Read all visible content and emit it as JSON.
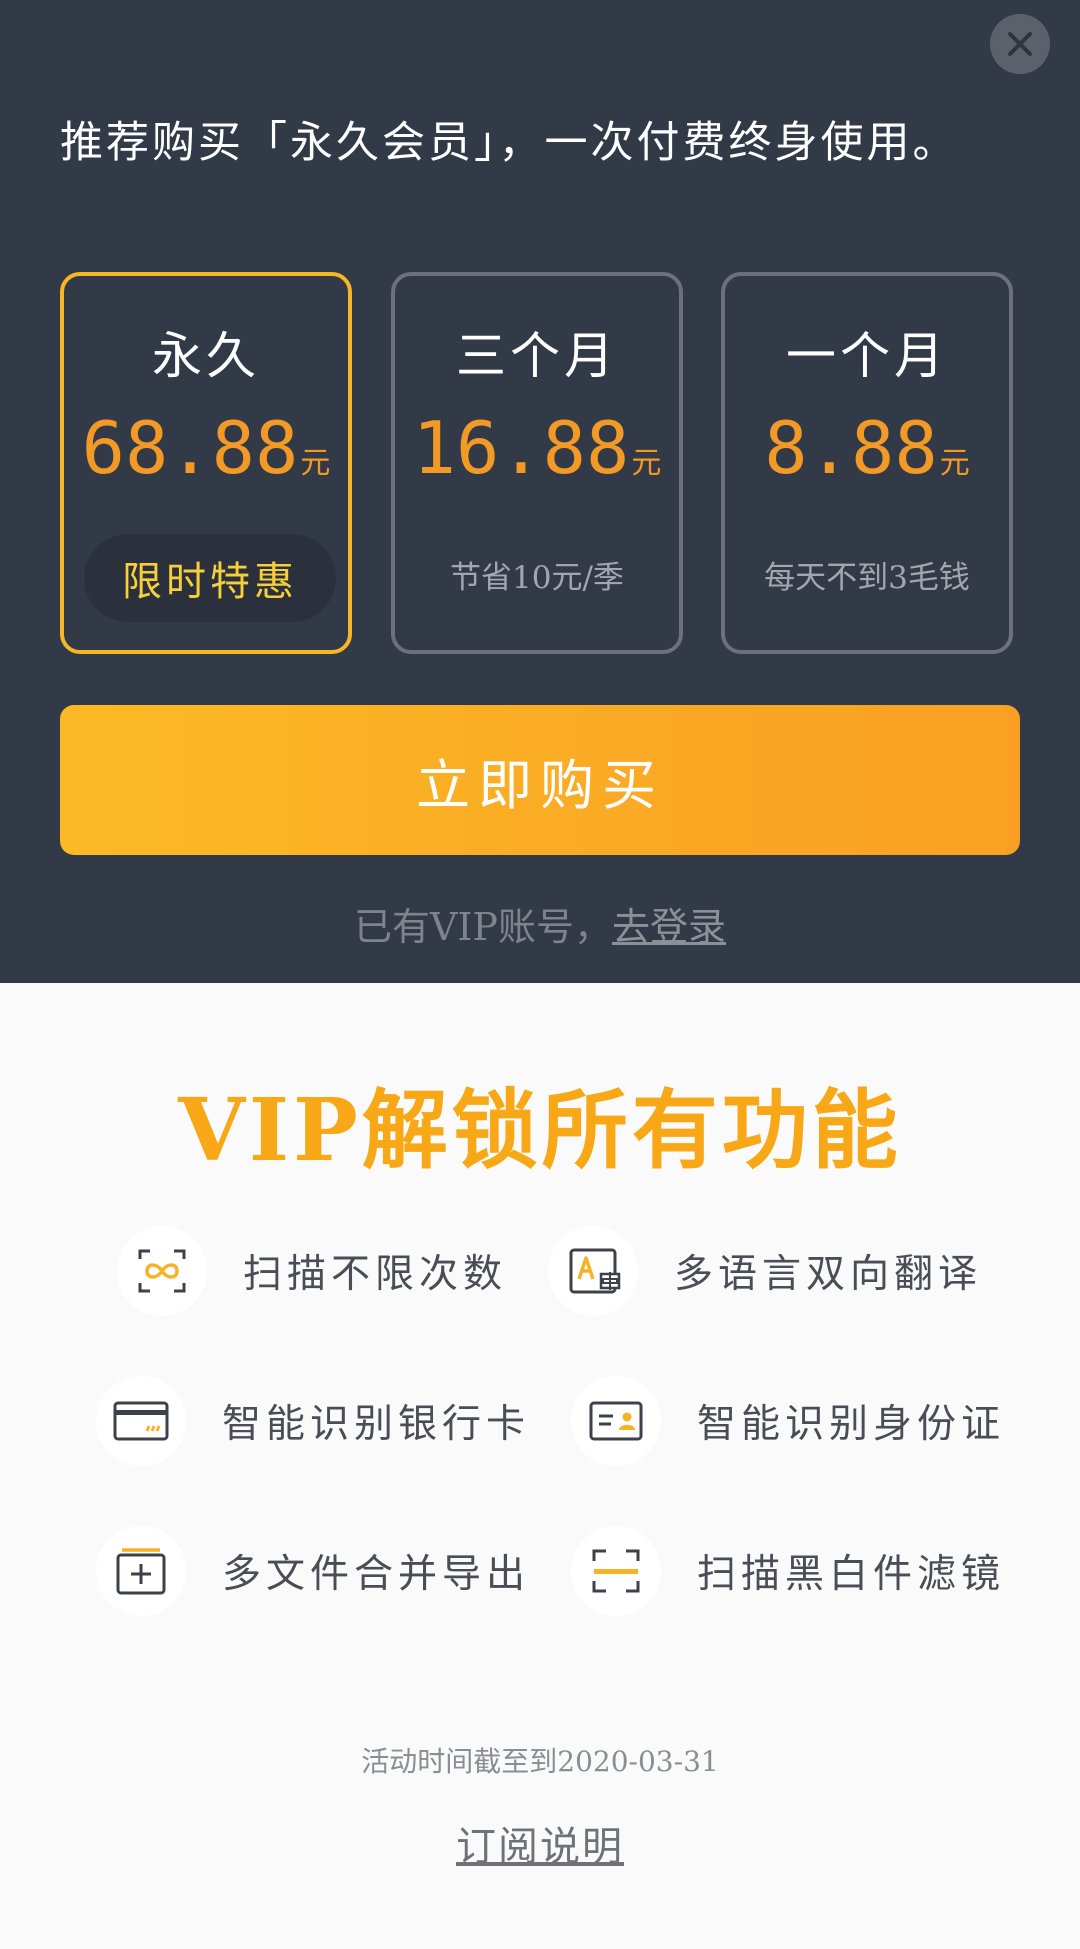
{
  "header": {
    "headline": "推荐购买「永久会员」，一次付费终身使用。"
  },
  "plans": [
    {
      "name": "永久",
      "price": "68.88",
      "unit": "元",
      "badge": "限时特惠",
      "selected": true
    },
    {
      "name": "三个月",
      "price": "16.88",
      "unit": "元",
      "note": "节省10元/季",
      "selected": false
    },
    {
      "name": "一个月",
      "price": "8.88",
      "unit": "元",
      "note": "每天不到3毛钱",
      "selected": false
    }
  ],
  "buy_button": {
    "label": "立即购买"
  },
  "login": {
    "prefix": "已有VIP账号，",
    "link": "去登录"
  },
  "vip": {
    "title": "VIP解锁所有功能"
  },
  "features": [
    {
      "label": "扫描不限次数",
      "icon": "infinity-scan-icon"
    },
    {
      "label": "多语言双向翻译",
      "icon": "translate-icon"
    },
    {
      "label": "智能识别银行卡",
      "icon": "bank-card-icon"
    },
    {
      "label": "智能识别身份证",
      "icon": "id-card-icon"
    },
    {
      "label": "多文件合并导出",
      "icon": "merge-files-icon"
    },
    {
      "label": "扫描黑白件滤镜",
      "icon": "bw-filter-icon"
    }
  ],
  "footer": {
    "deadline": "活动时间截至到2020-03-31",
    "subscription_link": "订阅说明"
  },
  "colors": {
    "top_background": "#333a47",
    "accent": "#f8a817",
    "price": "#f39a26",
    "selected_border": "#f6b627",
    "badge_text": "#f7cf3a"
  }
}
